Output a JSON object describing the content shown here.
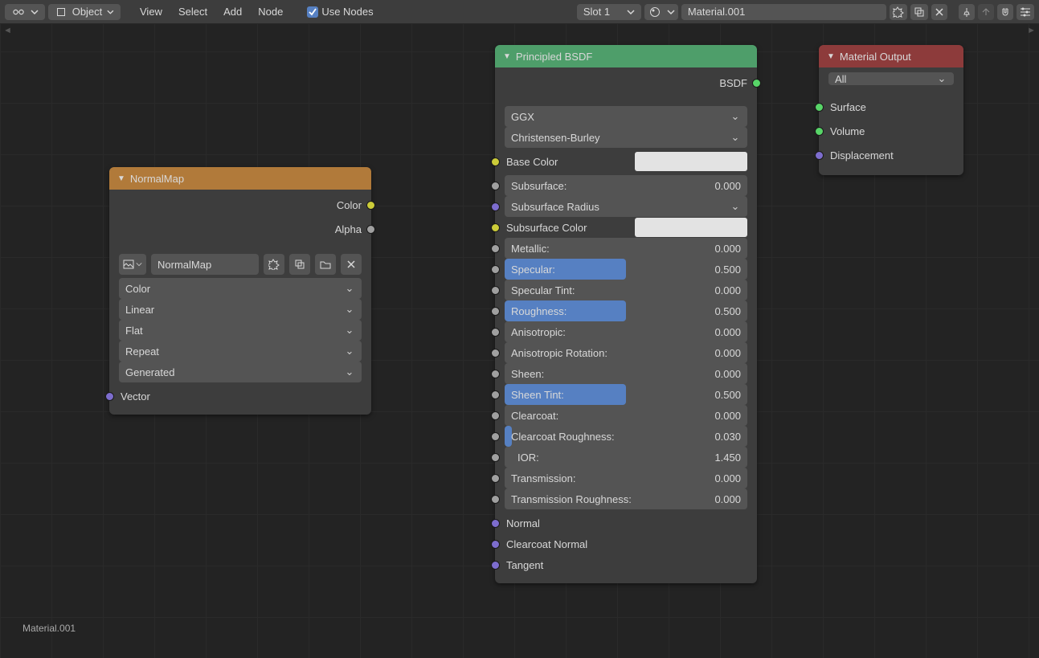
{
  "header": {
    "mode_label": "Object",
    "menus": [
      "View",
      "Select",
      "Add",
      "Node"
    ],
    "use_nodes_label": "Use Nodes",
    "use_nodes_checked": true,
    "slot_label": "Slot 1",
    "material_name": "Material.001"
  },
  "normalmap": {
    "title": "NormalMap",
    "outputs": [
      "Color",
      "Alpha"
    ],
    "tex_name": "NormalMap",
    "dropdowns": [
      "Color",
      "Linear",
      "Flat",
      "Repeat",
      "Generated"
    ],
    "vector_label": "Vector"
  },
  "bsdf": {
    "title": "Principled BSDF",
    "output": "BSDF",
    "dropdowns": [
      "GGX",
      "Christensen-Burley"
    ],
    "subsurface_radius": "Subsurface Radius",
    "subsurface_color": "Subsurface Color",
    "base_color": "Base Color",
    "sliders": [
      {
        "label": "Subsurface:",
        "value": "0.000",
        "fill": 0,
        "sock": "gray"
      },
      {
        "label": "Metallic:",
        "value": "0.000",
        "fill": 0,
        "sock": "gray"
      },
      {
        "label": "Specular:",
        "value": "0.500",
        "fill": 50,
        "sock": "gray"
      },
      {
        "label": "Specular Tint:",
        "value": "0.000",
        "fill": 0,
        "sock": "gray"
      },
      {
        "label": "Roughness:",
        "value": "0.500",
        "fill": 50,
        "sock": "gray"
      },
      {
        "label": "Anisotropic:",
        "value": "0.000",
        "fill": 0,
        "sock": "gray"
      },
      {
        "label": "Anisotropic Rotation:",
        "value": "0.000",
        "fill": 0,
        "sock": "gray"
      },
      {
        "label": "Sheen:",
        "value": "0.000",
        "fill": 0,
        "sock": "gray"
      },
      {
        "label": "Sheen Tint:",
        "value": "0.500",
        "fill": 50,
        "sock": "gray"
      },
      {
        "label": "Clearcoat:",
        "value": "0.000",
        "fill": 0,
        "sock": "gray"
      },
      {
        "label": "Clearcoat Roughness:",
        "value": "0.030",
        "fill": 3,
        "sock": "gray"
      },
      {
        "label": "IOR:",
        "value": "1.450",
        "fill": 0,
        "sock": "gray",
        "indent": true
      },
      {
        "label": "Transmission:",
        "value": "0.000",
        "fill": 0,
        "sock": "gray"
      },
      {
        "label": "Transmission Roughness:",
        "value": "0.000",
        "fill": 0,
        "sock": "gray"
      }
    ],
    "vec_inputs": [
      "Normal",
      "Clearcoat Normal",
      "Tangent"
    ]
  },
  "output": {
    "title": "Material Output",
    "target": "All",
    "inputs": [
      {
        "label": "Surface",
        "sock": "green"
      },
      {
        "label": "Volume",
        "sock": "green"
      },
      {
        "label": "Displacement",
        "sock": "purple"
      }
    ]
  },
  "footer_label": "Material.001"
}
